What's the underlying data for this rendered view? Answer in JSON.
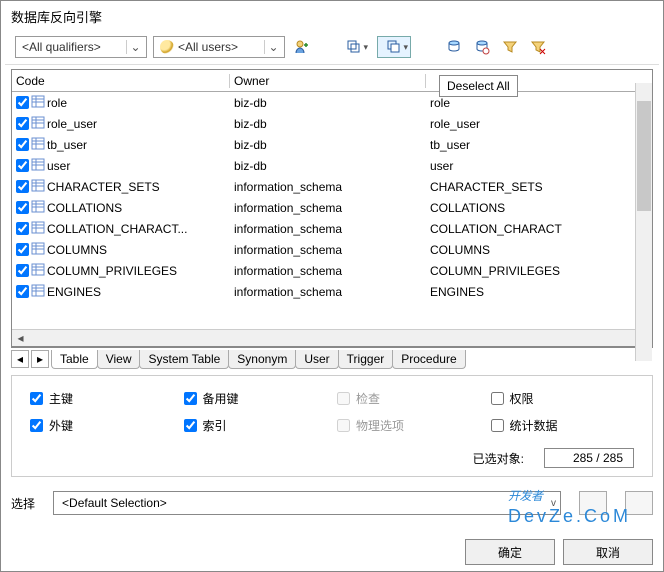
{
  "title": "数据库反向引擎",
  "toolbar": {
    "qualifiers_dd": "<All qualifiers>",
    "users_dd": "<All users>",
    "tooltip_deselect": "Deselect All"
  },
  "columns": {
    "code": "Code",
    "owner": "Owner",
    "name": ""
  },
  "rows": [
    {
      "checked": true,
      "code": "role",
      "owner": "biz-db",
      "name": "role"
    },
    {
      "checked": true,
      "code": "role_user",
      "owner": "biz-db",
      "name": "role_user"
    },
    {
      "checked": true,
      "code": "tb_user",
      "owner": "biz-db",
      "name": "tb_user"
    },
    {
      "checked": true,
      "code": "user",
      "owner": "biz-db",
      "name": "user"
    },
    {
      "checked": true,
      "code": "CHARACTER_SETS",
      "owner": "information_schema",
      "name": "CHARACTER_SETS"
    },
    {
      "checked": true,
      "code": "COLLATIONS",
      "owner": "information_schema",
      "name": "COLLATIONS"
    },
    {
      "checked": true,
      "code": "COLLATION_CHARACT...",
      "owner": "information_schema",
      "name": "COLLATION_CHARACT"
    },
    {
      "checked": true,
      "code": "COLUMNS",
      "owner": "information_schema",
      "name": "COLUMNS"
    },
    {
      "checked": true,
      "code": "COLUMN_PRIVILEGES",
      "owner": "information_schema",
      "name": "COLUMN_PRIVILEGES"
    },
    {
      "checked": true,
      "code": "ENGINES",
      "owner": "information_schema",
      "name": "ENGINES"
    }
  ],
  "tabs": [
    "Table",
    "View",
    "System Table",
    "Synonym",
    "User",
    "Trigger",
    "Procedure"
  ],
  "active_tab": 0,
  "options": {
    "pk": {
      "label": "主键",
      "checked": true,
      "enabled": true
    },
    "fk": {
      "label": "外键",
      "checked": true,
      "enabled": true
    },
    "ak": {
      "label": "备用键",
      "checked": true,
      "enabled": true
    },
    "idx": {
      "label": "索引",
      "checked": true,
      "enabled": true
    },
    "chk": {
      "label": "检查",
      "checked": false,
      "enabled": false
    },
    "phys": {
      "label": "物理选项",
      "checked": false,
      "enabled": false
    },
    "perm": {
      "label": "权限",
      "checked": false,
      "enabled": true
    },
    "stat": {
      "label": "统计数据",
      "checked": false,
      "enabled": true
    }
  },
  "count": {
    "label": "已选对象:",
    "value": "285 / 285"
  },
  "selection": {
    "label": "选择",
    "value": "<Default Selection>"
  },
  "buttons": {
    "ok": "确定",
    "cancel": "取消"
  },
  "brand": {
    "top": "开发者",
    "bottom": "DevZe.CoM"
  }
}
